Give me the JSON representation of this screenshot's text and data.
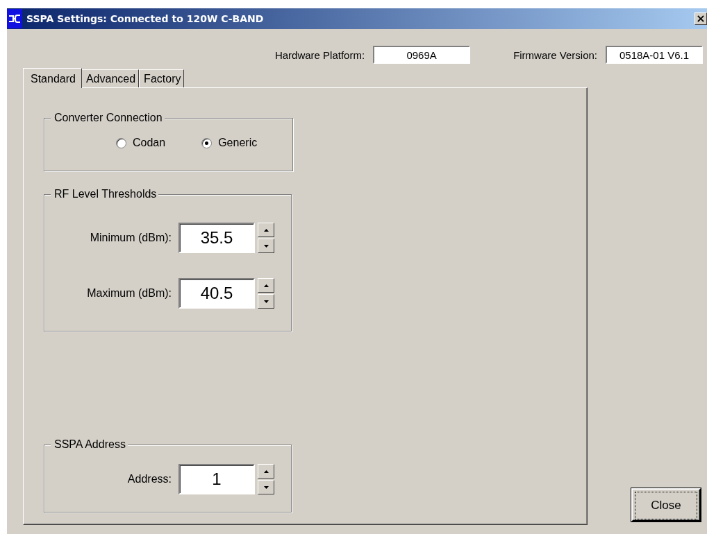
{
  "window": {
    "title": "SSPA Settings: Connected to 120W C-BAND",
    "close": "×"
  },
  "info": [
    {
      "label": "Hardware Platform:",
      "value": "0969A"
    },
    {
      "label": "Firmware Version:",
      "value": "0518A-01 V6.1"
    }
  ],
  "tabs": [
    {
      "label": "Standard",
      "selected": true
    },
    {
      "label": "Advanced",
      "selected": false
    },
    {
      "label": "Factory",
      "selected": false
    }
  ],
  "groups": [
    {
      "kind": "radio",
      "title": "Converter Connection",
      "options": [
        {
          "label": "Codan",
          "selected": false
        },
        {
          "label": "Generic",
          "selected": true
        }
      ]
    },
    {
      "kind": "spin",
      "title": "RF Level Thresholds",
      "fields": [
        {
          "label": "Minimum (dBm):",
          "value": "35.5"
        },
        {
          "label": "Maximum (dBm):",
          "value": "40.5"
        }
      ]
    },
    {
      "kind": "spin",
      "title": "SSPA Address",
      "fields": [
        {
          "label": "Address:",
          "value": "1"
        }
      ]
    }
  ],
  "close_button": {
    "label": "Close"
  }
}
